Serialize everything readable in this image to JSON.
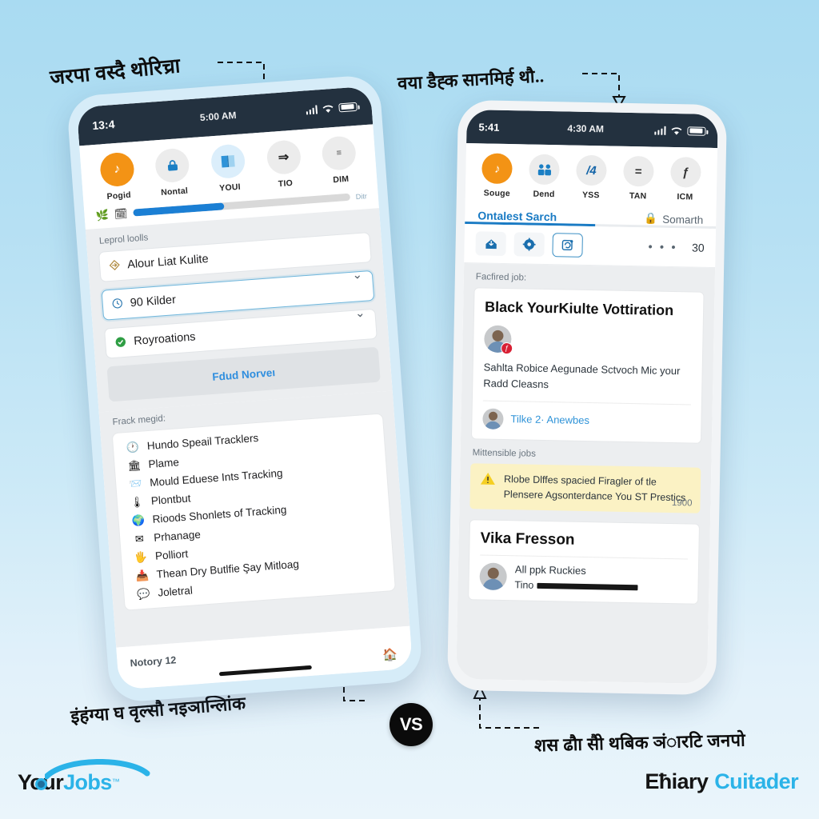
{
  "captions": {
    "top_left": "जरपा वस्दै थोरिच्रा",
    "top_right": "वया डैह्क सानमिर्ह थौ..",
    "bottom_left": "इंहंग्या घ वृल्सौ नइञान्लिांक",
    "bottom_right": "शस ढौा सैो थबिक ञंारटि जनपो",
    "vs": "VS"
  },
  "left_phone": {
    "status_bar": {
      "time": "13:4",
      "center": "5:00 AM"
    },
    "chips": [
      {
        "label": "Pogid",
        "icon": "orange-badge-icon",
        "glyph": "♪",
        "accent": true
      },
      {
        "label": "Nontal",
        "icon": "lock-icon",
        "glyph": "⬤"
      },
      {
        "label": "YOUI",
        "icon": "book-icon",
        "glyph": "◫"
      },
      {
        "label": "TIO",
        "icon": "arrow-right-icon",
        "glyph": "⇒"
      },
      {
        "label": "DIM",
        "icon": "sliders-icon",
        "glyph": "≡"
      }
    ],
    "progress": {
      "left_icons": [
        "leaf-icon",
        "calendar-icon"
      ],
      "percent": 42,
      "right_label": "Ditr"
    },
    "form": {
      "section_label": "Leprol loolls",
      "fields": [
        {
          "icon": "diamond-icon",
          "value": "Alour Liat Kulite",
          "chevron": false,
          "focused": false
        },
        {
          "icon": "clock-icon",
          "value": "90 Kilder",
          "chevron": true,
          "focused": true
        },
        {
          "icon": "check-circle-icon",
          "value": "Royroations",
          "chevron": true,
          "focused": false
        }
      ],
      "button_label": "Fdud Norveı"
    },
    "list": {
      "title": "Frack megid:",
      "items": [
        {
          "icon": "clock-icon",
          "label": "Hundo Speail Tracklers"
        },
        {
          "icon": "building-icon",
          "label": "Plame"
        },
        {
          "icon": "mail-open-icon",
          "label": "Mould Eduese Ints Tracking"
        },
        {
          "icon": "thermometer-icon",
          "label": "Plontbut"
        },
        {
          "icon": "globe-icon",
          "label": "Rioods Shonlets of Tracking"
        },
        {
          "icon": "envelope-icon",
          "label": "Prhanage"
        },
        {
          "icon": "hand-icon",
          "label": "Polliort"
        },
        {
          "icon": "inbox-icon",
          "label": "Thean Dry Butlfie Şay Mitloag"
        },
        {
          "icon": "chat-icon",
          "label": "Joletral"
        }
      ]
    },
    "footer": {
      "note": "Notory 12",
      "chrome_icon": "chrome-icon"
    }
  },
  "right_phone": {
    "status_bar": {
      "time": "5:41",
      "center": "4:30 AM"
    },
    "chips": [
      {
        "label": "Souge",
        "icon": "orange-badge-icon",
        "glyph": "♪",
        "accent": true
      },
      {
        "label": "Dend",
        "icon": "people-icon",
        "glyph": "♟"
      },
      {
        "label": "YSS",
        "icon": "slash-four-icon",
        "glyph": "/4"
      },
      {
        "label": "TAN",
        "icon": "equals-icon",
        "glyph": "="
      },
      {
        "label": "ICM",
        "icon": "bolt-icon",
        "glyph": "ƒ"
      }
    ],
    "tabs": {
      "active_label": "Ontalest Sarch",
      "right_label": "Somarth",
      "right_icon": "lock-icon",
      "underline_percent": 52
    },
    "toolbar": {
      "buttons": [
        {
          "icon": "inbox-arrow-icon",
          "glyph": "⤓",
          "outlined": false
        },
        {
          "icon": "gear-icon",
          "glyph": "⚙",
          "outlined": false
        },
        {
          "icon": "refresh-note-icon",
          "glyph": "↻",
          "outlined": true
        }
      ],
      "dots": "• • •",
      "count": "30"
    },
    "feed": {
      "featured_label": "Facfired job:",
      "featured_card": {
        "title": "Black YourKiulte Vottiration",
        "avatar_badge": "ƒ",
        "body": "Sahlta Robice Aegunade Sctvoch Mic your Radd Cleasns",
        "foot_link": "Tilke 2· Anewbes"
      },
      "secondary_label": "Mittensible jobs",
      "alert": {
        "icon": "warning-icon",
        "text": "Rlobe Dlffes spacied Firagler of tle Plensere Agsonterdance You ST Prestics",
        "number": "1900"
      },
      "second_card": {
        "title": "Vika Fresson",
        "line1": "All ppk Ruckies",
        "line2_prefix": "Tino"
      }
    }
  },
  "logos": {
    "left": {
      "your": "Your",
      "jobs": "Jobs",
      "tm": "™"
    },
    "right": {
      "first": "Eħiary",
      "second": "Cuitader"
    }
  },
  "colors": {
    "accent_orange": "#f39315",
    "accent_blue": "#1a7bc4",
    "status_bar": "#23313f",
    "alert_yellow": "#fbf2c4",
    "badge_red": "#d81f33",
    "background_top": "#a9dbf2",
    "background_bottom": "#eaf5fb"
  }
}
